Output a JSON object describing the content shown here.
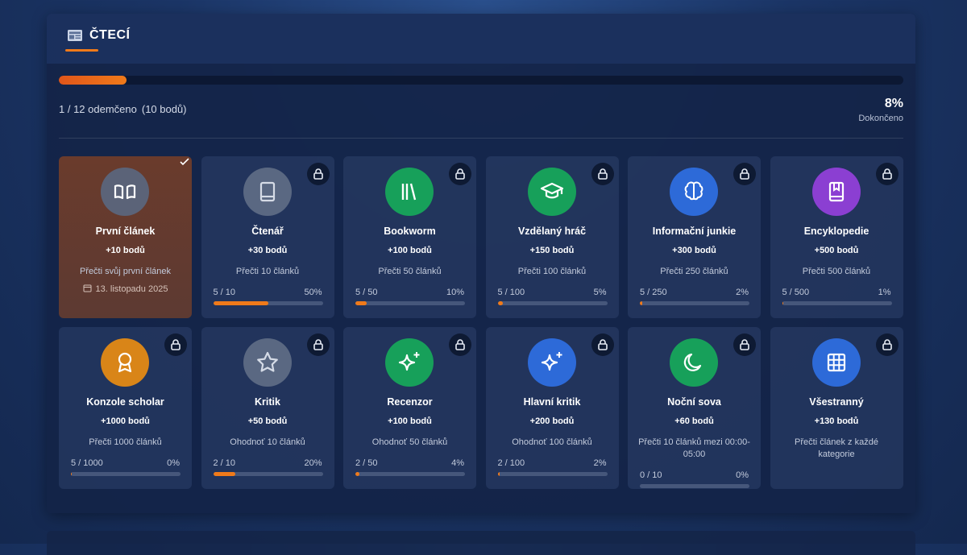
{
  "section": {
    "title": "ČTECÍ",
    "unlocked_text": "1 / 12 odemčeno",
    "points_text": "(10 bodů)",
    "percent_text": "8%",
    "percent_label": "Dokončeno",
    "progress_fraction": 0.08
  },
  "colors": {
    "accent": "#f07a1a"
  },
  "achievements": [
    {
      "title": "První článek",
      "points": "+10 bodů",
      "desc": "Přečti svůj první článek",
      "date": "13. listopadu 2025",
      "unlocked": true,
      "icon": "book-open-icon",
      "icon_bg": "#5b6378"
    },
    {
      "title": "Čtenář",
      "points": "+30 bodů",
      "desc": "Přečti 10 článků",
      "progress_text": "5 / 10",
      "percent": "50%",
      "fraction": 0.5,
      "icon": "book-icon",
      "icon_bg": "#5a6882"
    },
    {
      "title": "Bookworm",
      "points": "+100 bodů",
      "desc": "Přečti 50 článků",
      "progress_text": "5 / 50",
      "percent": "10%",
      "fraction": 0.1,
      "icon": "library-icon",
      "icon_bg": "#17a05a"
    },
    {
      "title": "Vzdělaný hráč",
      "points": "+150 bodů",
      "desc": "Přečti 100 článků",
      "progress_text": "5 / 100",
      "percent": "5%",
      "fraction": 0.05,
      "icon": "graduation-cap-icon",
      "icon_bg": "#17a05a"
    },
    {
      "title": "Informační junkie",
      "points": "+300 bodů",
      "desc": "Přečti 250 článků",
      "progress_text": "5 / 250",
      "percent": "2%",
      "fraction": 0.02,
      "icon": "brain-icon",
      "icon_bg": "#2d6ad8"
    },
    {
      "title": "Encyklopedie",
      "points": "+500 bodů",
      "desc": "Přečti 500 článků",
      "progress_text": "5 / 500",
      "percent": "1%",
      "fraction": 0.01,
      "icon": "book-bookmark-icon",
      "icon_bg": "#8b3fd2"
    },
    {
      "title": "Konzole scholar",
      "points": "+1000 bodů",
      "desc": "Přečti 1000 článků",
      "progress_text": "5 / 1000",
      "percent": "0%",
      "fraction": 0.005,
      "icon": "award-icon",
      "icon_bg": "#d98518"
    },
    {
      "title": "Kritik",
      "points": "+50 bodů",
      "desc": "Ohodnoť 10 článků",
      "progress_text": "2 / 10",
      "percent": "20%",
      "fraction": 0.2,
      "icon": "star-icon",
      "icon_bg": "#5a6882"
    },
    {
      "title": "Recenzor",
      "points": "+100 bodů",
      "desc": "Ohodnoť 50 článků",
      "progress_text": "2 / 50",
      "percent": "4%",
      "fraction": 0.04,
      "icon": "sparkles-icon",
      "icon_bg": "#17a05a"
    },
    {
      "title": "Hlavní kritik",
      "points": "+200 bodů",
      "desc": "Ohodnoť 100 článků",
      "progress_text": "2 / 100",
      "percent": "2%",
      "fraction": 0.02,
      "icon": "sparkles-icon",
      "icon_bg": "#2d6ad8"
    },
    {
      "title": "Noční sova",
      "points": "+60 bodů",
      "desc": "Přečti 10 článků mezi 00:00-05:00",
      "progress_text": "0 / 10",
      "percent": "0%",
      "fraction": 0,
      "icon": "moon-icon",
      "icon_bg": "#17a05a"
    },
    {
      "title": "Všestranný",
      "points": "+130 bodů",
      "desc": "Přečti článek z každé kategorie",
      "icon": "grid-icon",
      "icon_bg": "#2d6ad8"
    }
  ]
}
